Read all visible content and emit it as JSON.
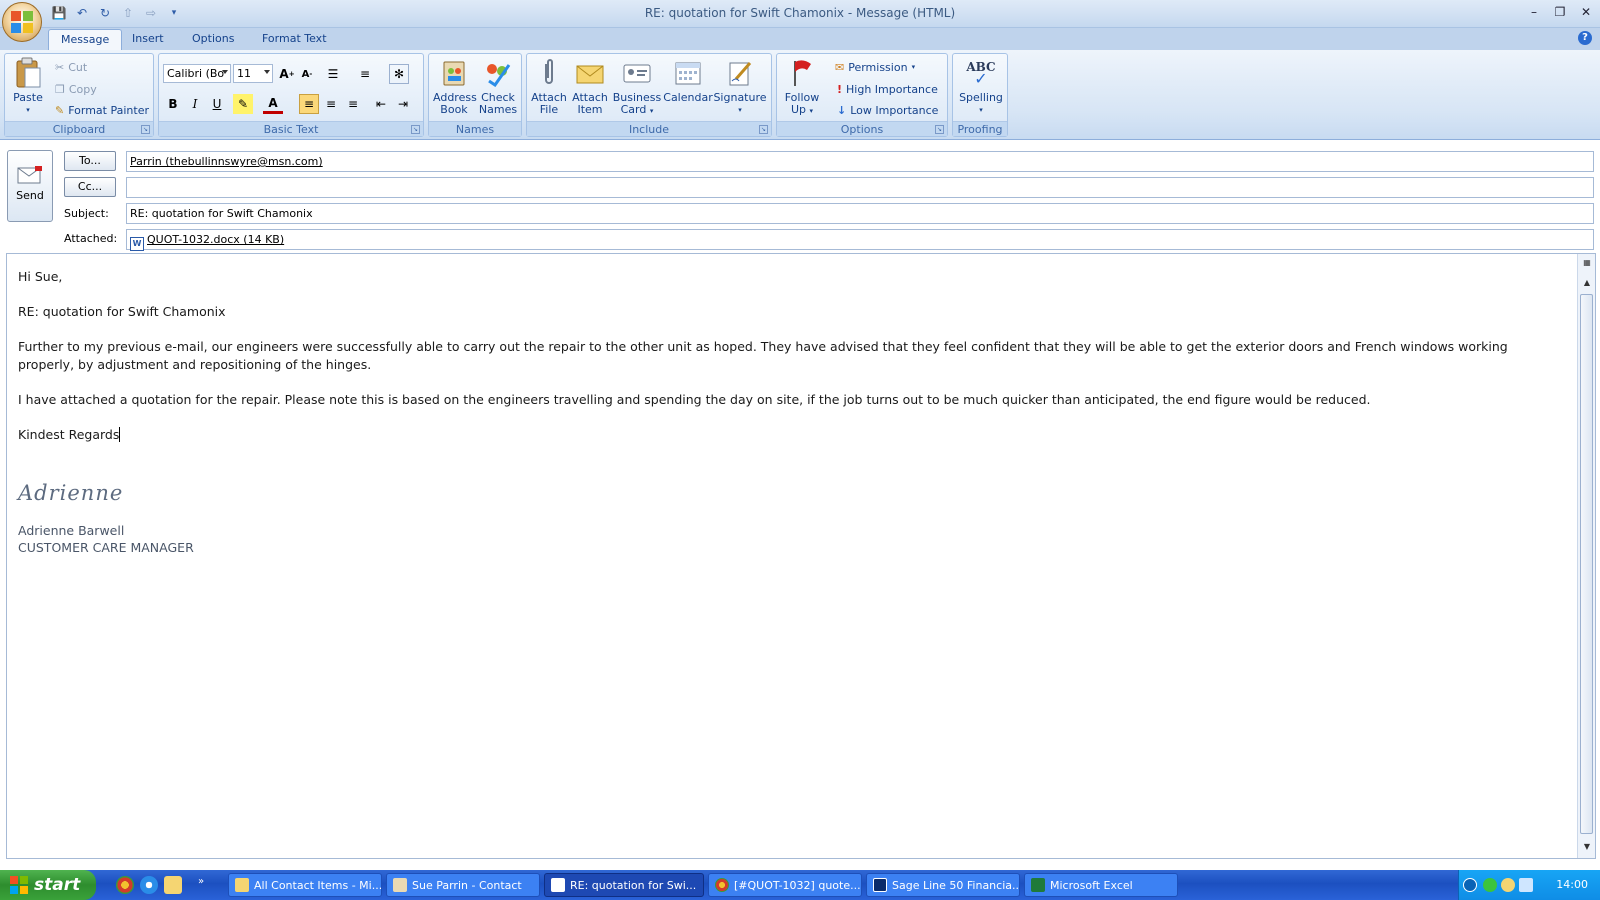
{
  "window": {
    "title": "RE: quotation for Swift Chamonix - Message (HTML)"
  },
  "tabs": [
    {
      "label": "Message"
    },
    {
      "label": "Insert"
    },
    {
      "label": "Options"
    },
    {
      "label": "Format Text"
    }
  ],
  "ribbon": {
    "clipboard": {
      "label": "Clipboard",
      "paste": "Paste",
      "cut": "Cut",
      "copy": "Copy",
      "format_painter": "Format Painter"
    },
    "basic_text": {
      "label": "Basic Text",
      "font": "Calibri (Bo",
      "size": "11"
    },
    "names": {
      "label": "Names",
      "address_book_1": "Address",
      "address_book_2": "Book",
      "check_names_1": "Check",
      "check_names_2": "Names"
    },
    "include": {
      "label": "Include",
      "attach_file_1": "Attach",
      "attach_file_2": "File",
      "attach_item_1": "Attach",
      "attach_item_2": "Item",
      "business_card_1": "Business",
      "business_card_2": "Card",
      "calendar": "Calendar",
      "signature": "Signature"
    },
    "options": {
      "label": "Options",
      "follow_up_1": "Follow",
      "follow_up_2": "Up",
      "permission": "Permission",
      "high_importance": "High Importance",
      "low_importance": "Low Importance"
    },
    "proofing": {
      "label": "Proofing",
      "spelling": "Spelling",
      "spelling_icon_text": "ABC"
    }
  },
  "header": {
    "send": "Send",
    "to_button": "To...",
    "to_value": "Parrin (thebullinnswyre@msn.com)",
    "cc_button": "Cc...",
    "cc_value": "",
    "subject_label": "Subject:",
    "subject_value": "RE: quotation for Swift Chamonix",
    "attached_label": "Attached:",
    "attachment": "QUOT-1032.docx (14 KB)"
  },
  "body": {
    "greeting": "Hi Sue,",
    "subject_line": "RE: quotation for Swift Chamonix",
    "paragraph1": "Further to my previous e-mail, our engineers were successfully able to carry out the repair to the other unit as hoped.  They have advised that they feel confident that they will be able to get the exterior doors and French windows working properly, by adjustment and repositioning of the hinges.",
    "paragraph2": "I have attached a quotation for the repair.  Please note this is based on the engineers travelling and spending the day on site, if the job turns out to be much quicker than anticipated, the end figure would be reduced.",
    "closing": "Kindest Regards",
    "signature_script": "Adrienne",
    "signature_name": "Adrienne Barwell",
    "signature_title": "CUSTOMER CARE MANAGER"
  },
  "taskbar": {
    "start": "start",
    "tasks": [
      {
        "label": "All Contact Items - Mi..."
      },
      {
        "label": "Sue Parrin - Contact"
      },
      {
        "label": "RE: quotation for Swi..."
      },
      {
        "label": "[#QUOT-1032] quote..."
      },
      {
        "label": "Sage Line 50 Financia..."
      },
      {
        "label": "Microsoft Excel"
      }
    ],
    "clock": "14:00"
  },
  "colors": {
    "ribbon_text": "#15428b",
    "taskbar_blue": "#245edb",
    "start_green": "#3aa23a",
    "active_align": "#fbd87a"
  }
}
